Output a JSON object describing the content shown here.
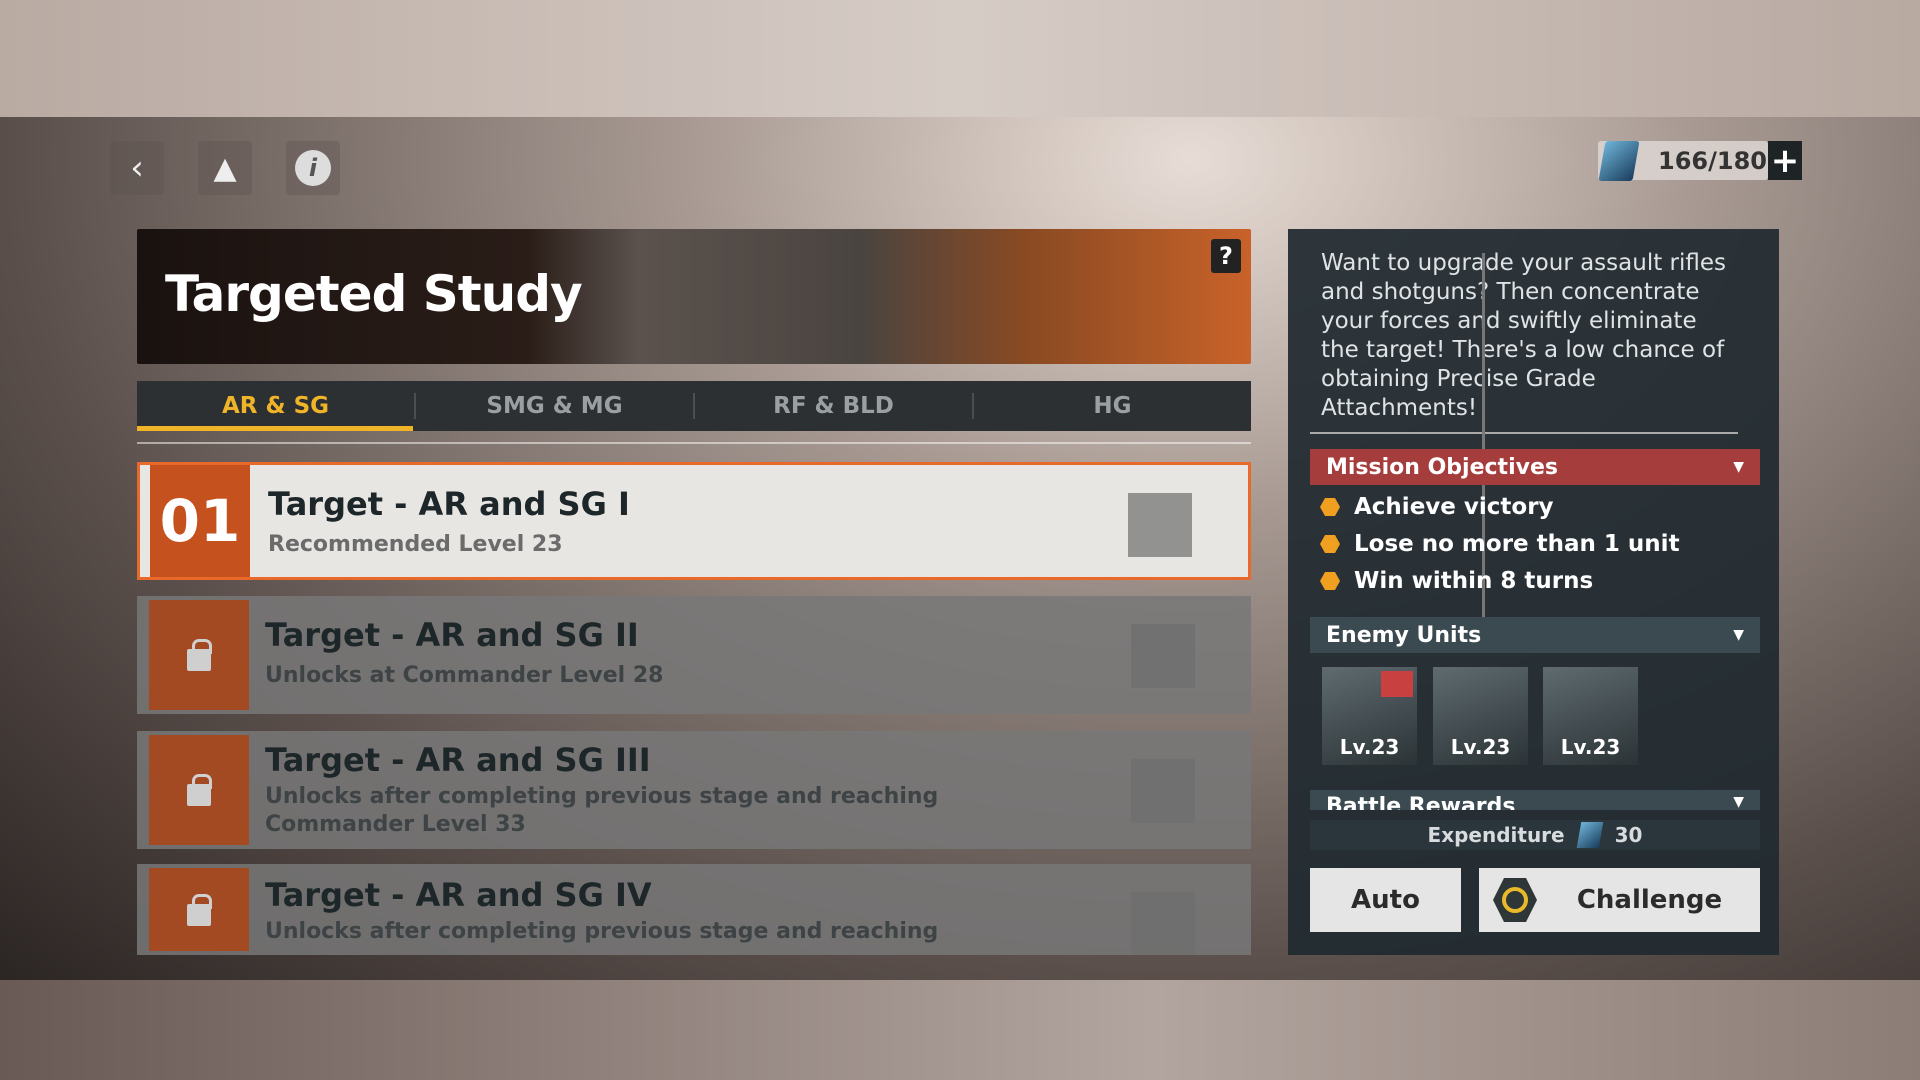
{
  "header": {
    "back_icon": "chevron-left-icon",
    "home_icon": "triangle-logo-icon",
    "info_icon": "info-icon",
    "stamina": "166/180",
    "stamina_icon": "battery-card-icon",
    "add_icon": "plus-icon"
  },
  "banner": {
    "title": "Targeted Study",
    "help": "?"
  },
  "tabs": [
    {
      "label": "AR & SG",
      "active": true
    },
    {
      "label": "SMG & MG"
    },
    {
      "label": "RF & BLD"
    },
    {
      "label": "HG"
    }
  ],
  "stages": [
    {
      "number": "01",
      "title": "Target - AR and SG I",
      "subtitle": "Recommended Level 23",
      "locked": false,
      "selected": true
    },
    {
      "title": "Target - AR and SG II",
      "subtitle": "Unlocks at Commander Level 28",
      "locked": true
    },
    {
      "title": "Target - AR and SG III",
      "subtitle": "Unlocks after completing previous stage and reaching Commander Level 33",
      "locked": true
    },
    {
      "title": "Target - AR and SG IV",
      "subtitle": "Unlocks after completing previous stage and reaching",
      "locked": true
    }
  ],
  "details": {
    "description": "Want to upgrade your assault rifles and shotguns? Then concentrate your forces and swiftly eliminate the target! There's a low chance of obtaining Precise Grade Attachments!",
    "objectives_title": "Mission Objectives",
    "objectives": [
      "Achieve victory",
      "Lose no more than 1 unit",
      "Win within 8 turns"
    ],
    "enemies_title": "Enemy Units",
    "enemies": [
      {
        "level": "Lv.23"
      },
      {
        "level": "Lv.23"
      },
      {
        "level": "Lv.23"
      }
    ],
    "rewards_title": "Battle Rewards",
    "expenditure_label": "Expenditure",
    "expenditure_value": "30"
  },
  "actions": {
    "auto": "Auto",
    "challenge": "Challenge"
  },
  "colors": {
    "accent": "#f0b429",
    "selected_border": "#e8692a",
    "objectives_header": "#a63d3d"
  }
}
